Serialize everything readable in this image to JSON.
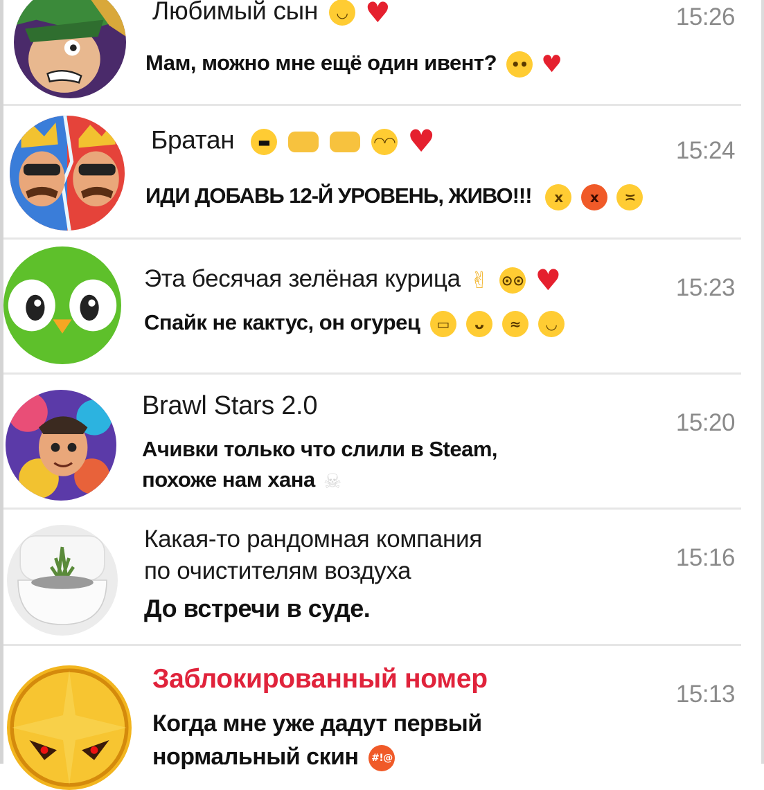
{
  "chats": [
    {
      "name": "Любимый сын",
      "name_emoji": [
        "smiling-face-icon",
        "heart-on-fire-icon"
      ],
      "message": "Мам, можно мне ещё один ивент?",
      "message_emoji": [
        "pleading-face-icon",
        "mending-heart-icon"
      ],
      "time": "15:26"
    },
    {
      "name": "Братан",
      "name_emoji": [
        "sunglasses-face-icon",
        "left-fist-icon",
        "right-fist-icon",
        "relieved-face-icon",
        "red-heart-icon"
      ],
      "message": "ИДИ ДОБАВЬ 12-Й УРОВЕНЬ, ЖИВО!!!",
      "message_emoji": [
        "angry-face-icon",
        "pouting-face-icon",
        "steam-nose-face-icon"
      ],
      "time": "15:24"
    },
    {
      "name": "Эта бесячая зелёная курица",
      "name_emoji": [
        "victory-hand-icon",
        "flushed-face-icon",
        "broken-heart-icon"
      ],
      "message": "Спайк не кактус, он огурец",
      "message_emoji": [
        "grinning-face-icon",
        "grinning-big-eyes-icon",
        "rofl-face-icon",
        "tears-of-joy-icon"
      ],
      "time": "15:23"
    },
    {
      "name": "Brawl Stars 2.0",
      "message_line1": "Ачивки только что слили в Steam,",
      "message_line2": "похоже нам хана",
      "message_emoji": [
        "skull-icon"
      ],
      "time": "15:20"
    },
    {
      "name_line1": "Какая-то рандомная компания",
      "name_line2": "по очистителям воздуха",
      "message": "До встречи в суде.",
      "time": "15:16"
    },
    {
      "name": "Заблокированный номер",
      "message_line1": "Когда мне уже дадут первый",
      "message_line2": "нормальный скин",
      "message_emoji": [
        "cursing-face-icon"
      ],
      "time": "15:13",
      "accent": "#e0233b"
    }
  ]
}
